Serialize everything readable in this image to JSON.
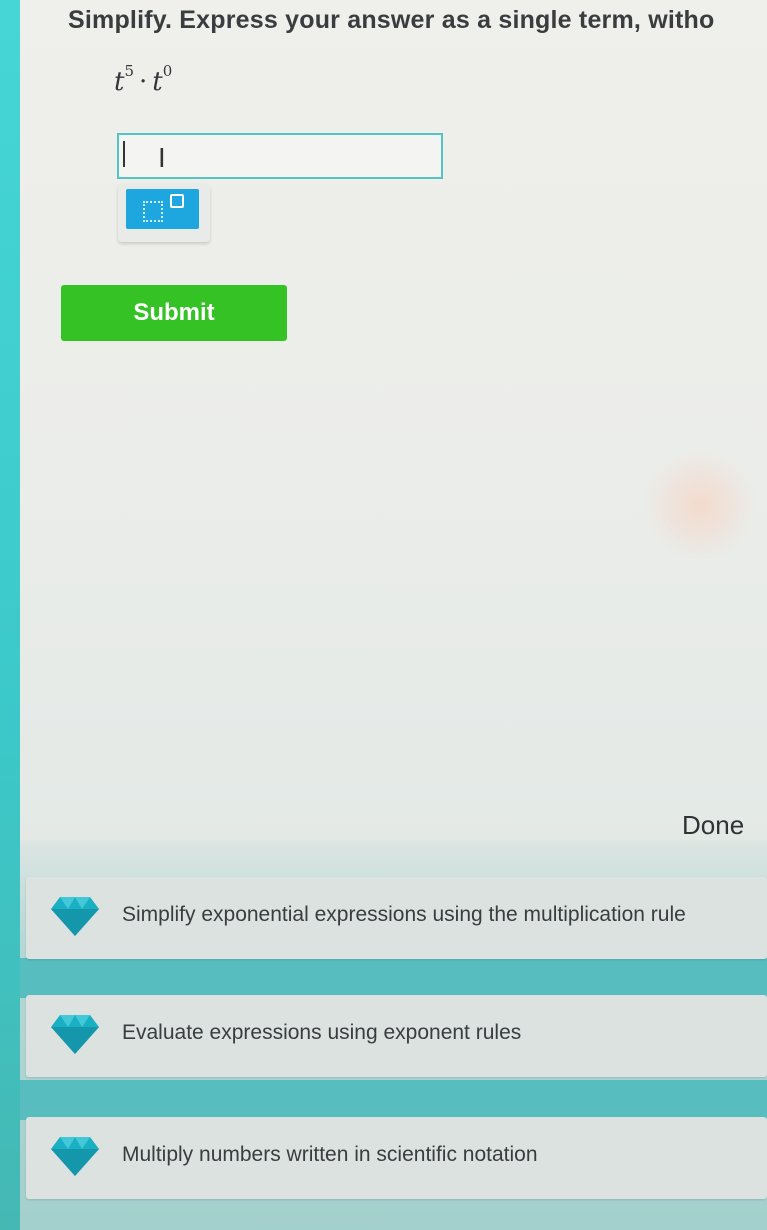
{
  "question": {
    "text": "Simplify. Express your answer as a single term, witho",
    "expression": {
      "base1": "t",
      "exp1": "5",
      "operator": "·",
      "base2": "t",
      "exp2": "0"
    }
  },
  "answer": {
    "value": "",
    "placeholder": ""
  },
  "palette": {
    "exponent_button_icon": "exponent-template-icon"
  },
  "submit": {
    "label": "Submit"
  },
  "done": {
    "label": "Done"
  },
  "skills": [
    {
      "label": "Simplify exponential expressions using the multiplication rule"
    },
    {
      "label": "Evaluate expressions using exponent rules"
    },
    {
      "label": "Multiply numbers written in scientific notation"
    }
  ],
  "colors": {
    "accent_teal": "#57c2c6",
    "exponent_button": "#1ea6df",
    "submit_green": "#34c224",
    "gem_teal": "#1ab0c4"
  }
}
